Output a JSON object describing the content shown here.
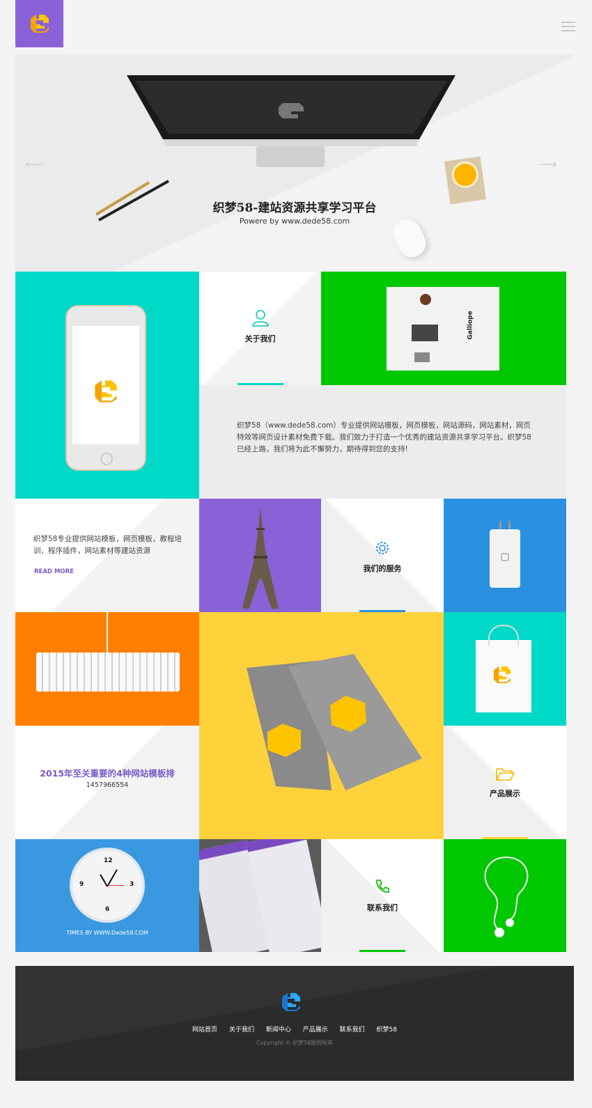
{
  "header": {
    "logo_icon": "g-logo-icon",
    "menu_icon": "hamburger-icon"
  },
  "hero": {
    "title": "织梦58-建站资源共享学习平台",
    "subtitle": "Powere by www.dede58.com",
    "prev_icon": "arrow-left-icon",
    "next_icon": "arrow-right-icon"
  },
  "about": {
    "label": "关于我们",
    "text": "织梦58（www.dede58.com）专业提供网站模板，网页模板，网站源码，网站素材，网页特效等网页设计素材免费下载。我们致力于打造一个优秀的建站资源共享学习平台。织梦58已经上路，我们将为此不懈努力，期待得到您的支持!"
  },
  "intro": {
    "text": "织梦58专业提供网站模板，网页模板，教程培训，程序插件，网站素材等建站资源",
    "read_more": "READ MORE"
  },
  "services": {
    "label": "我们的服务"
  },
  "article": {
    "title": "2015年至关重要的4种网站模板排",
    "number": "1457966554"
  },
  "products": {
    "label": "产品展示"
  },
  "clock": {
    "caption": "TIMES BY WWW.Dede58.COM",
    "n12": "12",
    "n3": "3",
    "n6": "6",
    "n9": "9"
  },
  "contact": {
    "label": "联系我们"
  },
  "gallery_text": {
    "card": "Galliope"
  },
  "footer": {
    "nav": [
      "网站首页",
      "关于我们",
      "新闻中心",
      "产品展示",
      "联系我们",
      "织梦58"
    ],
    "copyright": "Copyright © 织梦58版权所有"
  },
  "colors": {
    "purple": "#8a62d8",
    "teal": "#00d8c8",
    "green": "#00c800",
    "blue": "#2a90e0",
    "orange": "#ff8000",
    "yellow": "#ffd23c",
    "clock_blue": "#3a98e0",
    "footer": "#2b2b2b"
  }
}
